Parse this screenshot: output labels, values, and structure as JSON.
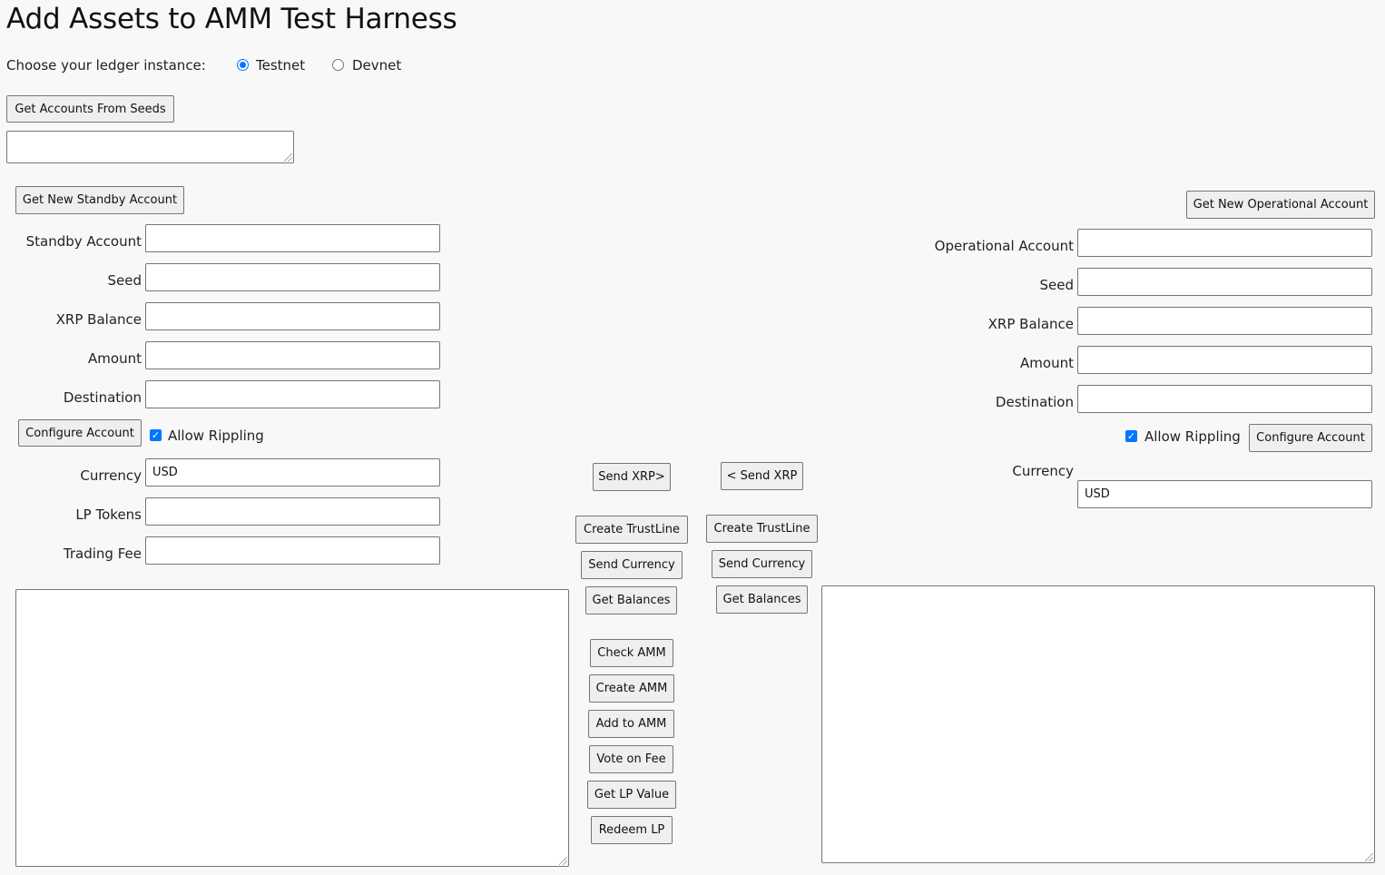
{
  "page": {
    "title": "Add Assets to AMM Test Harness",
    "ledger_prompt": "Choose your ledger instance:",
    "ledger_options": [
      {
        "label": "Testnet",
        "selected": true
      },
      {
        "label": "Devnet",
        "selected": false
      }
    ],
    "get_accounts_button": "Get Accounts From Seeds",
    "seeds_textarea_value": ""
  },
  "standby": {
    "get_account_button": "Get New Standby Account",
    "fields": [
      {
        "label": "Standby Account",
        "value": ""
      },
      {
        "label": "Seed",
        "value": ""
      },
      {
        "label": "XRP Balance",
        "value": ""
      },
      {
        "label": "Amount",
        "value": ""
      },
      {
        "label": "Destination",
        "value": ""
      }
    ],
    "configure_button": "Configure Account",
    "allow_rippling_label": "Allow Rippling",
    "allow_rippling_checked": true,
    "currency_label": "Currency",
    "currency_value": "USD",
    "lp_tokens_label": "LP Tokens",
    "lp_tokens_value": "",
    "trading_fee_label": "Trading Fee",
    "trading_fee_value": "",
    "results_value": ""
  },
  "operational": {
    "get_account_button": "Get New Operational Account",
    "fields": [
      {
        "label": "Operational Account",
        "value": ""
      },
      {
        "label": "Seed",
        "value": ""
      },
      {
        "label": "XRP Balance",
        "value": ""
      },
      {
        "label": "Amount",
        "value": ""
      },
      {
        "label": "Destination",
        "value": ""
      }
    ],
    "allow_rippling_label": "Allow Rippling",
    "allow_rippling_checked": true,
    "configure_button": "Configure Account",
    "currency_label": "Currency",
    "currency_value": "USD",
    "results_value": ""
  },
  "middle": {
    "standby_buttons": {
      "send_xrp": "Send XRP>",
      "create_trustline": "Create TrustLine",
      "send_currency": "Send Currency",
      "get_balances": "Get Balances",
      "check_amm": "Check AMM",
      "create_amm": "Create AMM",
      "add_to_amm": "Add to AMM",
      "vote_on_fee": "Vote on Fee",
      "get_lp_value": "Get LP Value",
      "redeem_lp": "Redeem LP"
    },
    "operational_buttons": {
      "send_xrp": "< Send XRP",
      "create_trustline": "Create TrustLine",
      "send_currency": "Send Currency",
      "get_balances": "Get Balances"
    }
  },
  "colors": {
    "background": "#f8f8f8",
    "accent": "#0075ff",
    "button_face": "#efefef",
    "border": "#767676"
  }
}
